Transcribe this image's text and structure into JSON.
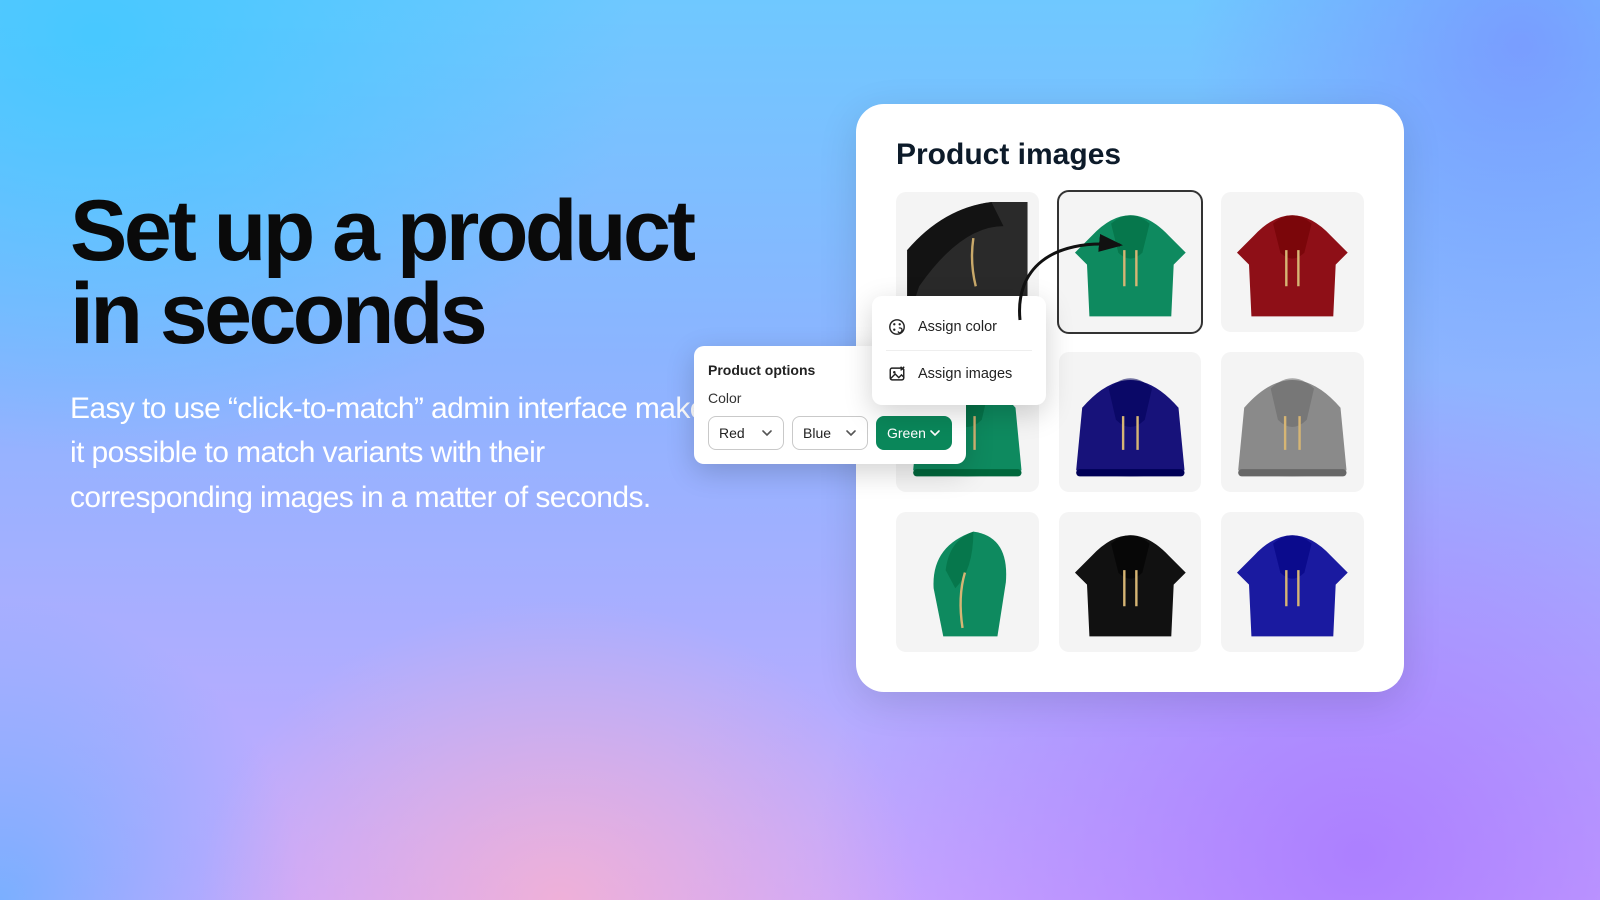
{
  "hero": {
    "title": "Set up a product in seconds",
    "subtitle": "Easy to use “click-to-match” admin interface makes it possible to match variants with their corresponding images in a matter of seconds."
  },
  "card": {
    "title": "Product images",
    "images": [
      {
        "name": "black-hoodie-close",
        "color": "#2a2a2a",
        "selected": false
      },
      {
        "name": "green-hoodie-front",
        "color": "#0e8a5f",
        "selected": true
      },
      {
        "name": "red-hoodie-front",
        "color": "#8e0f17",
        "selected": false
      },
      {
        "name": "green-hoodie-crop",
        "color": "#0e8a5f",
        "selected": false
      },
      {
        "name": "navy-hoodie-crop",
        "color": "#17127a",
        "selected": false
      },
      {
        "name": "grey-hoodie-crop",
        "color": "#8a8a8a",
        "selected": false
      },
      {
        "name": "green-hoodie-side",
        "color": "#0e8a5f",
        "selected": false
      },
      {
        "name": "black-hoodie-front",
        "color": "#111111",
        "selected": false
      },
      {
        "name": "navy-hoodie-front",
        "color": "#1a1aa0",
        "selected": false
      }
    ]
  },
  "options": {
    "panel_title": "Product options",
    "label": "Color",
    "chips": [
      {
        "label": "Red",
        "active": false
      },
      {
        "label": "Blue",
        "active": false
      },
      {
        "label": "Green",
        "active": true
      }
    ]
  },
  "menu": {
    "items": [
      {
        "icon": "palette-icon",
        "label": "Assign color"
      },
      {
        "icon": "image-x-icon",
        "label": "Assign images"
      }
    ]
  }
}
